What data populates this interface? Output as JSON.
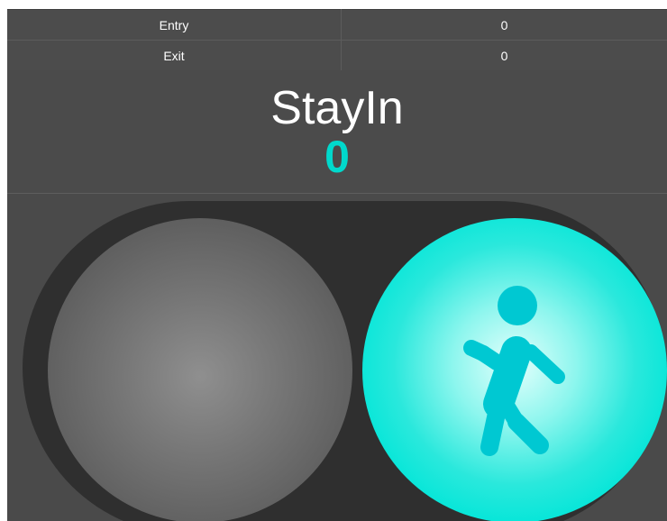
{
  "counters": {
    "entry_label": "Entry",
    "entry_value": "0",
    "exit_label": "Exit",
    "exit_value": "0"
  },
  "stay_in": {
    "title": "StayIn",
    "value": "0"
  },
  "traffic_light": {
    "stop_lamp": "off",
    "walk_lamp": "on",
    "walk_icon": "walking-person-icon"
  },
  "colors": {
    "accent": "#00d9cc",
    "background": "#4a4a4a",
    "housing": "#2f2f2f"
  }
}
